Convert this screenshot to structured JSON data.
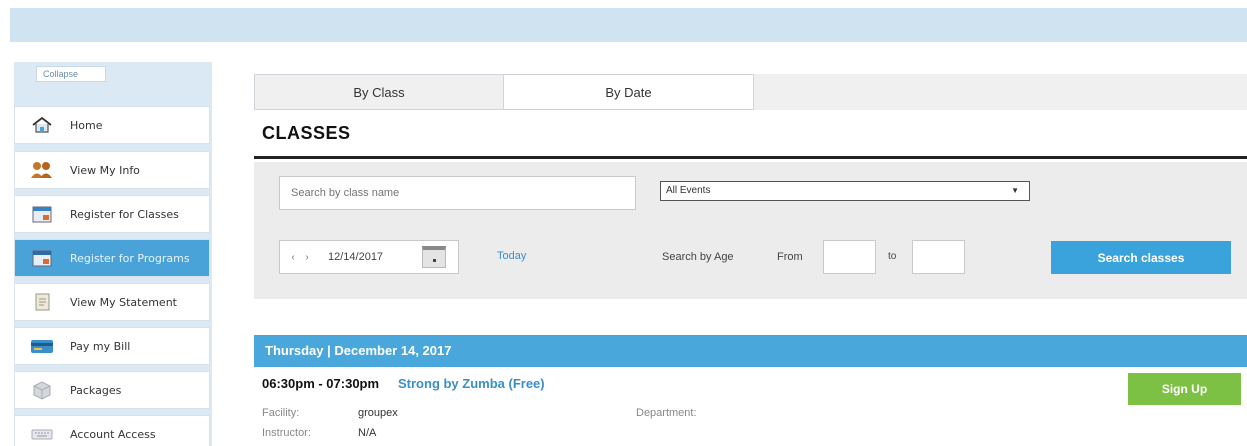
{
  "sidebar": {
    "collapse_label": "Collapse",
    "items": [
      {
        "label": "Home",
        "icon": "home-icon"
      },
      {
        "label": "View My Info",
        "icon": "people-icon"
      },
      {
        "label": "Register for Classes",
        "icon": "calendar-icon"
      },
      {
        "label": "Register for Programs",
        "icon": "calendar-icon"
      },
      {
        "label": "View My Statement",
        "icon": "statement-icon"
      },
      {
        "label": "Pay my Bill",
        "icon": "card-icon"
      },
      {
        "label": "Packages",
        "icon": "package-icon"
      },
      {
        "label": "Account Access",
        "icon": "keyboard-icon"
      }
    ],
    "active_index": 3
  },
  "tabs": [
    {
      "label": "By Class"
    },
    {
      "label": "By Date"
    }
  ],
  "page_title": "CLASSES",
  "search": {
    "class_placeholder": "Search by class name",
    "events_selected": "All Events",
    "date": "12/14/2017",
    "today_label": "Today",
    "age_label": "Search by Age",
    "from_label": "From",
    "to_label": "to",
    "button_label": "Search classes"
  },
  "results": {
    "day_header": "Thursday | December 14, 2017",
    "classes": [
      {
        "time": "06:30pm - 07:30pm",
        "name": "Strong by Zumba (Free)",
        "signup_label": "Sign Up",
        "facility_label": "Facility:",
        "facility": "groupex",
        "department_label": "Department:",
        "department": "",
        "instructor_label": "Instructor:",
        "instructor": "N/A"
      }
    ]
  },
  "colors": {
    "accent_blue": "#4aa7dc",
    "signup_green": "#7cc143",
    "topbar": "#cfe3f0"
  }
}
